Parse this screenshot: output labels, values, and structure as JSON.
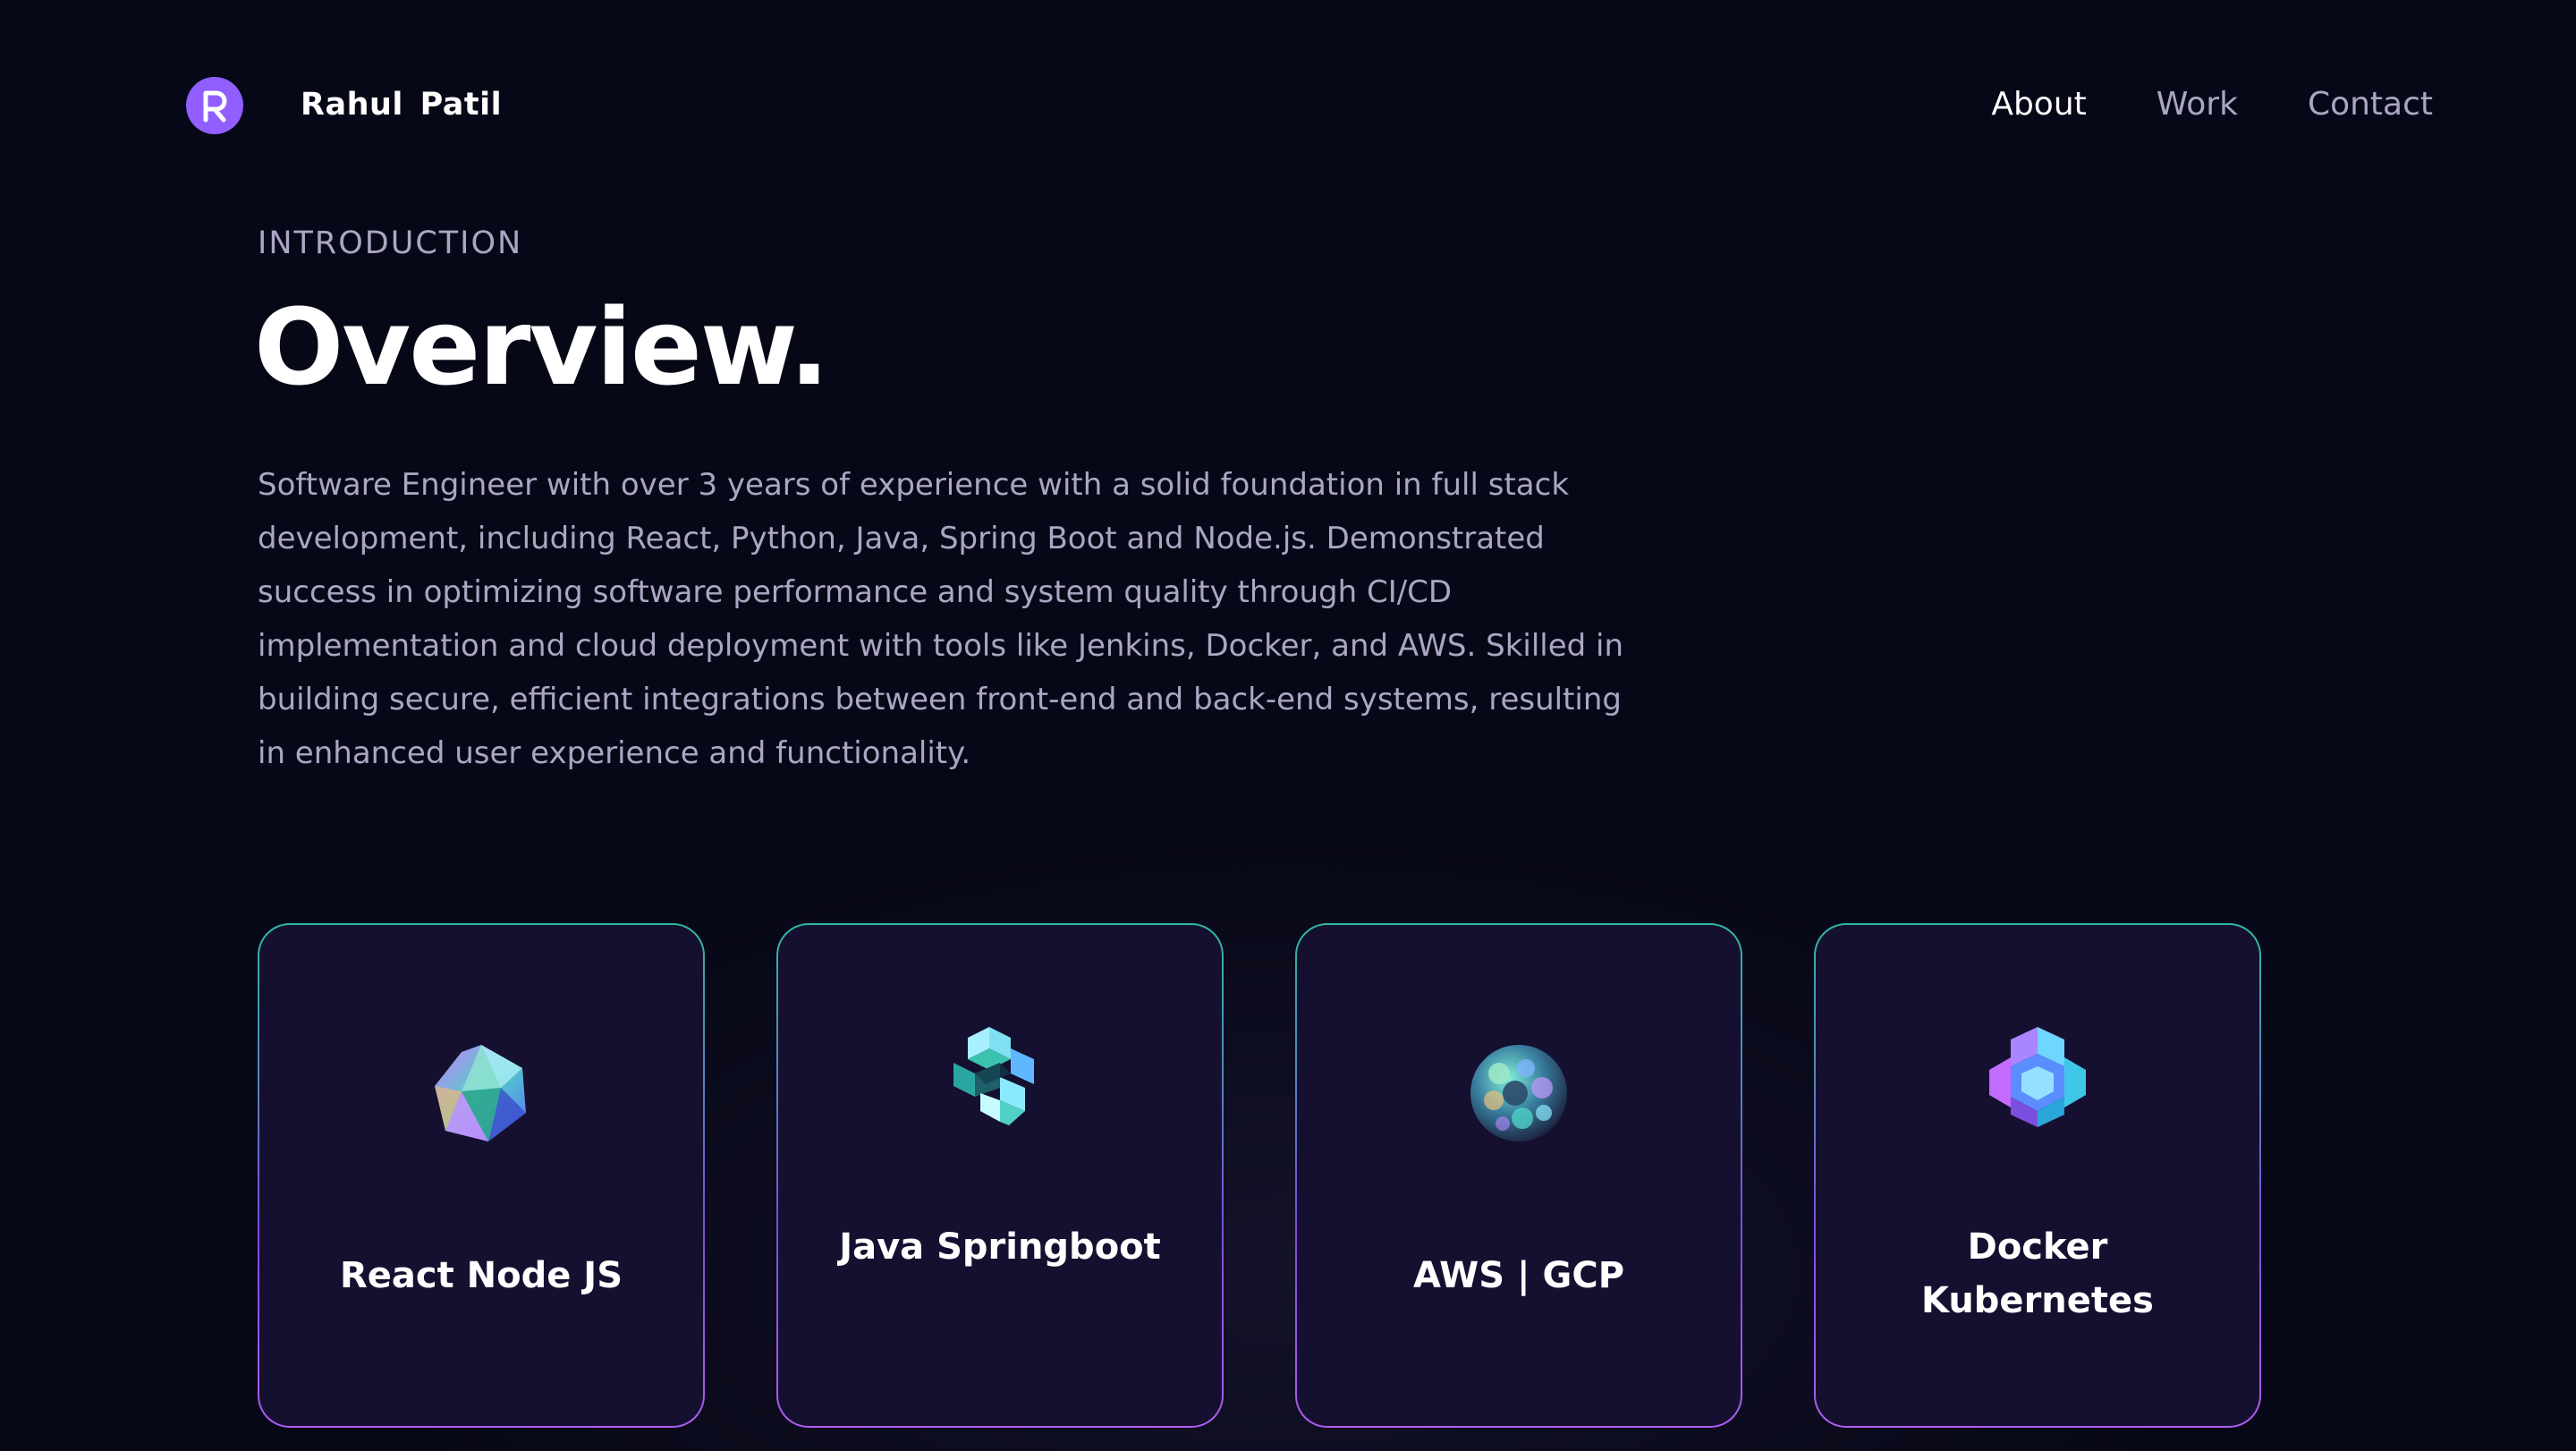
{
  "brand": {
    "name": "Rahul  Patil",
    "logo_letter": "R"
  },
  "nav": {
    "links": [
      "About",
      "Work",
      "Contact"
    ],
    "active": "About"
  },
  "intro": {
    "subtitle": "INTRODUCTION",
    "title": "Overview.",
    "description": "Software Engineer with over 3 years of experience with a solid foundation in full stack development, including React, Python, Java, Spring Boot and Node.js. Demonstrated success in optimizing software performance and system quality through CI/CD implementation and cloud deployment with tools like Jenkins, Docker, and AWS. Skilled in building secure, efficient integrations between front-end and back-end systems, resulting in enhanced user experience and functionality."
  },
  "cards": [
    {
      "title": "React Node JS",
      "icon": "icosahedron-icon"
    },
    {
      "title": "Java Springboot",
      "icon": "cube-cluster-icon"
    },
    {
      "title": "AWS | GCP",
      "icon": "sphere-icon"
    },
    {
      "title": "Docker Kubernetes",
      "icon": "hexagon-knot-icon"
    }
  ],
  "colors": {
    "background": "#070817",
    "accent": "#915eff",
    "muted_text": "#aaa6c3",
    "card_background": "#151030",
    "card_border_top": "#2fb9a0",
    "card_border_bottom": "#b05cf0"
  }
}
